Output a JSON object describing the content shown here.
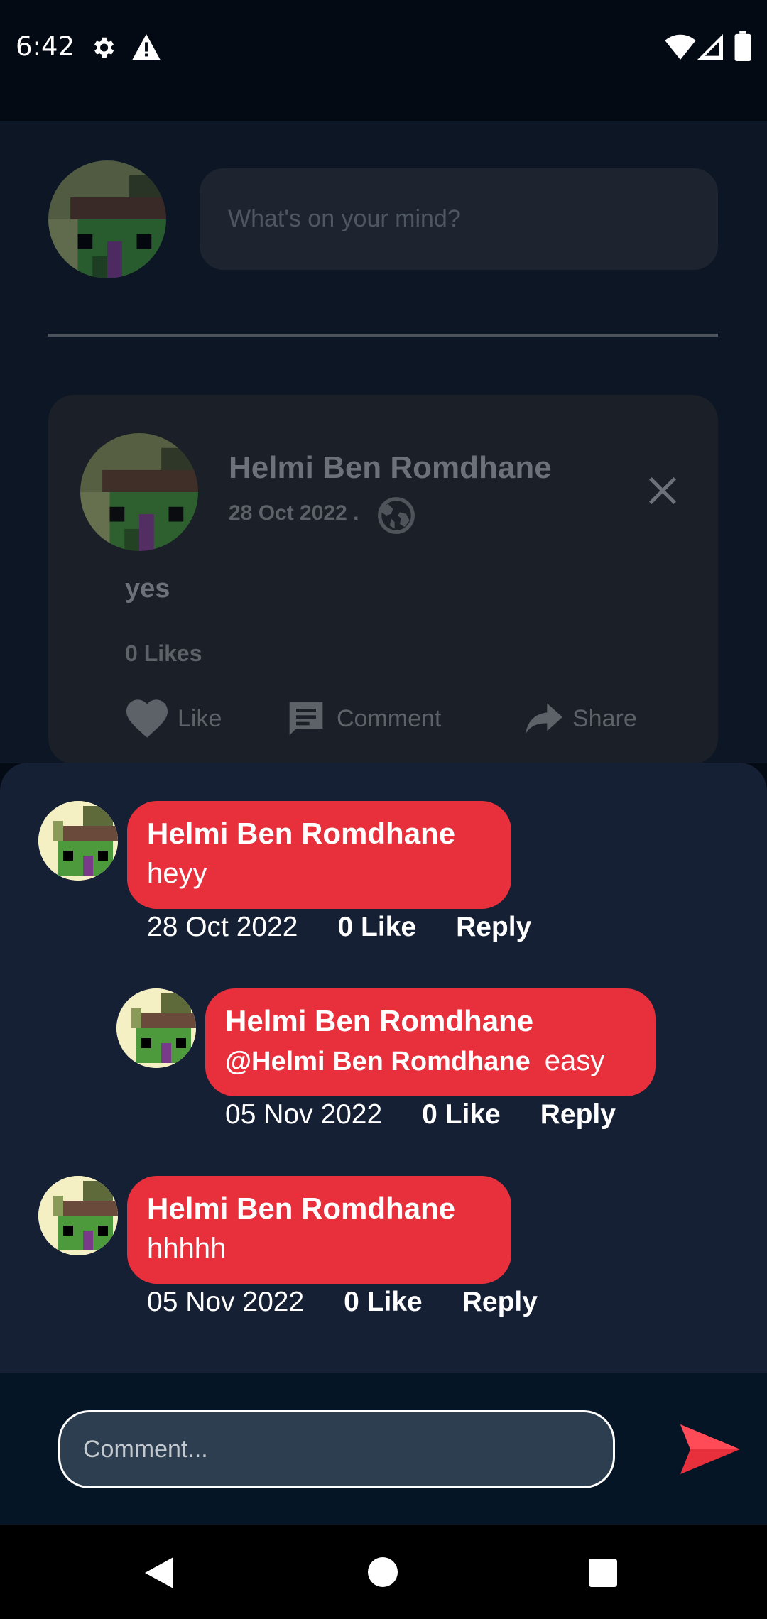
{
  "status_bar": {
    "time": "6:42"
  },
  "composer": {
    "placeholder": "What's on your mind?"
  },
  "post": {
    "author": "Helmi Ben Romdhane",
    "date": "28 Oct 2022 .",
    "text": "yes",
    "likes": "0 Likes",
    "actions": {
      "like": "Like",
      "comment": "Comment",
      "share": "Share"
    }
  },
  "comments": [
    {
      "author": "Helmi Ben Romdhane",
      "text": "heyy",
      "date": "28 Oct 2022",
      "likes": "0 Like",
      "reply": "Reply"
    },
    {
      "author": "Helmi Ben Romdhane",
      "mention": "@Helmi Ben Romdhane",
      "text": "easy",
      "date": "05 Nov 2022",
      "likes": "0 Like",
      "reply": "Reply"
    },
    {
      "author": "Helmi Ben Romdhane",
      "text": "hhhhh",
      "date": "05 Nov 2022",
      "likes": "0 Like",
      "reply": "Reply"
    }
  ],
  "comment_bar": {
    "placeholder": "Comment..."
  },
  "colors": {
    "accent": "#e8303d",
    "sheet": "#162034"
  }
}
